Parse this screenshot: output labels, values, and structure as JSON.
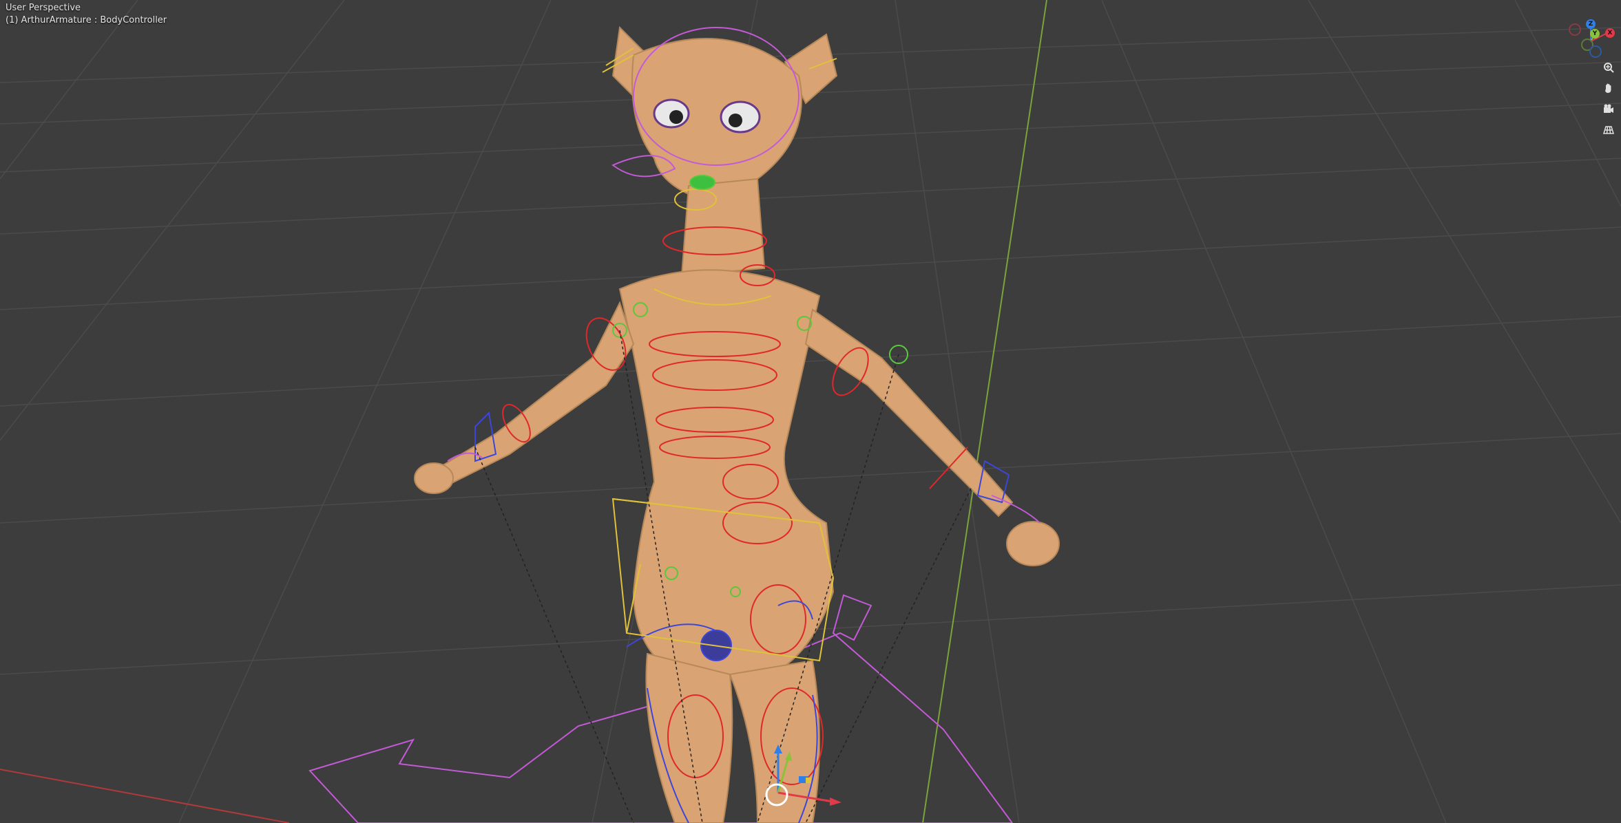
{
  "viewport": {
    "view_mode": "User Perspective",
    "object_info": "(1) ArthurArmature : BodyController"
  },
  "nav_gizmo": {
    "axes": [
      {
        "label": "Z",
        "color": "#2f7fe6"
      },
      {
        "label": "Y",
        "color": "#8ac33b"
      },
      {
        "label": "X",
        "color": "#e2394b"
      }
    ],
    "tools": [
      {
        "icon": "zoom-icon"
      },
      {
        "icon": "pan-hand-icon"
      },
      {
        "icon": "camera-icon"
      },
      {
        "icon": "grid-toggle-icon"
      }
    ]
  },
  "colors": {
    "background": "#3d3d3d",
    "grid": "#4a4a4a",
    "x_axis": "#b03a3a",
    "y_axis": "#7aa33a",
    "skin": "#d9a373",
    "bone_red": "#e0282a",
    "bone_blue": "#3c46d8",
    "bone_magenta": "#c35ad6",
    "bone_yellow": "#e0c23a",
    "bone_green": "#5ac83c"
  }
}
